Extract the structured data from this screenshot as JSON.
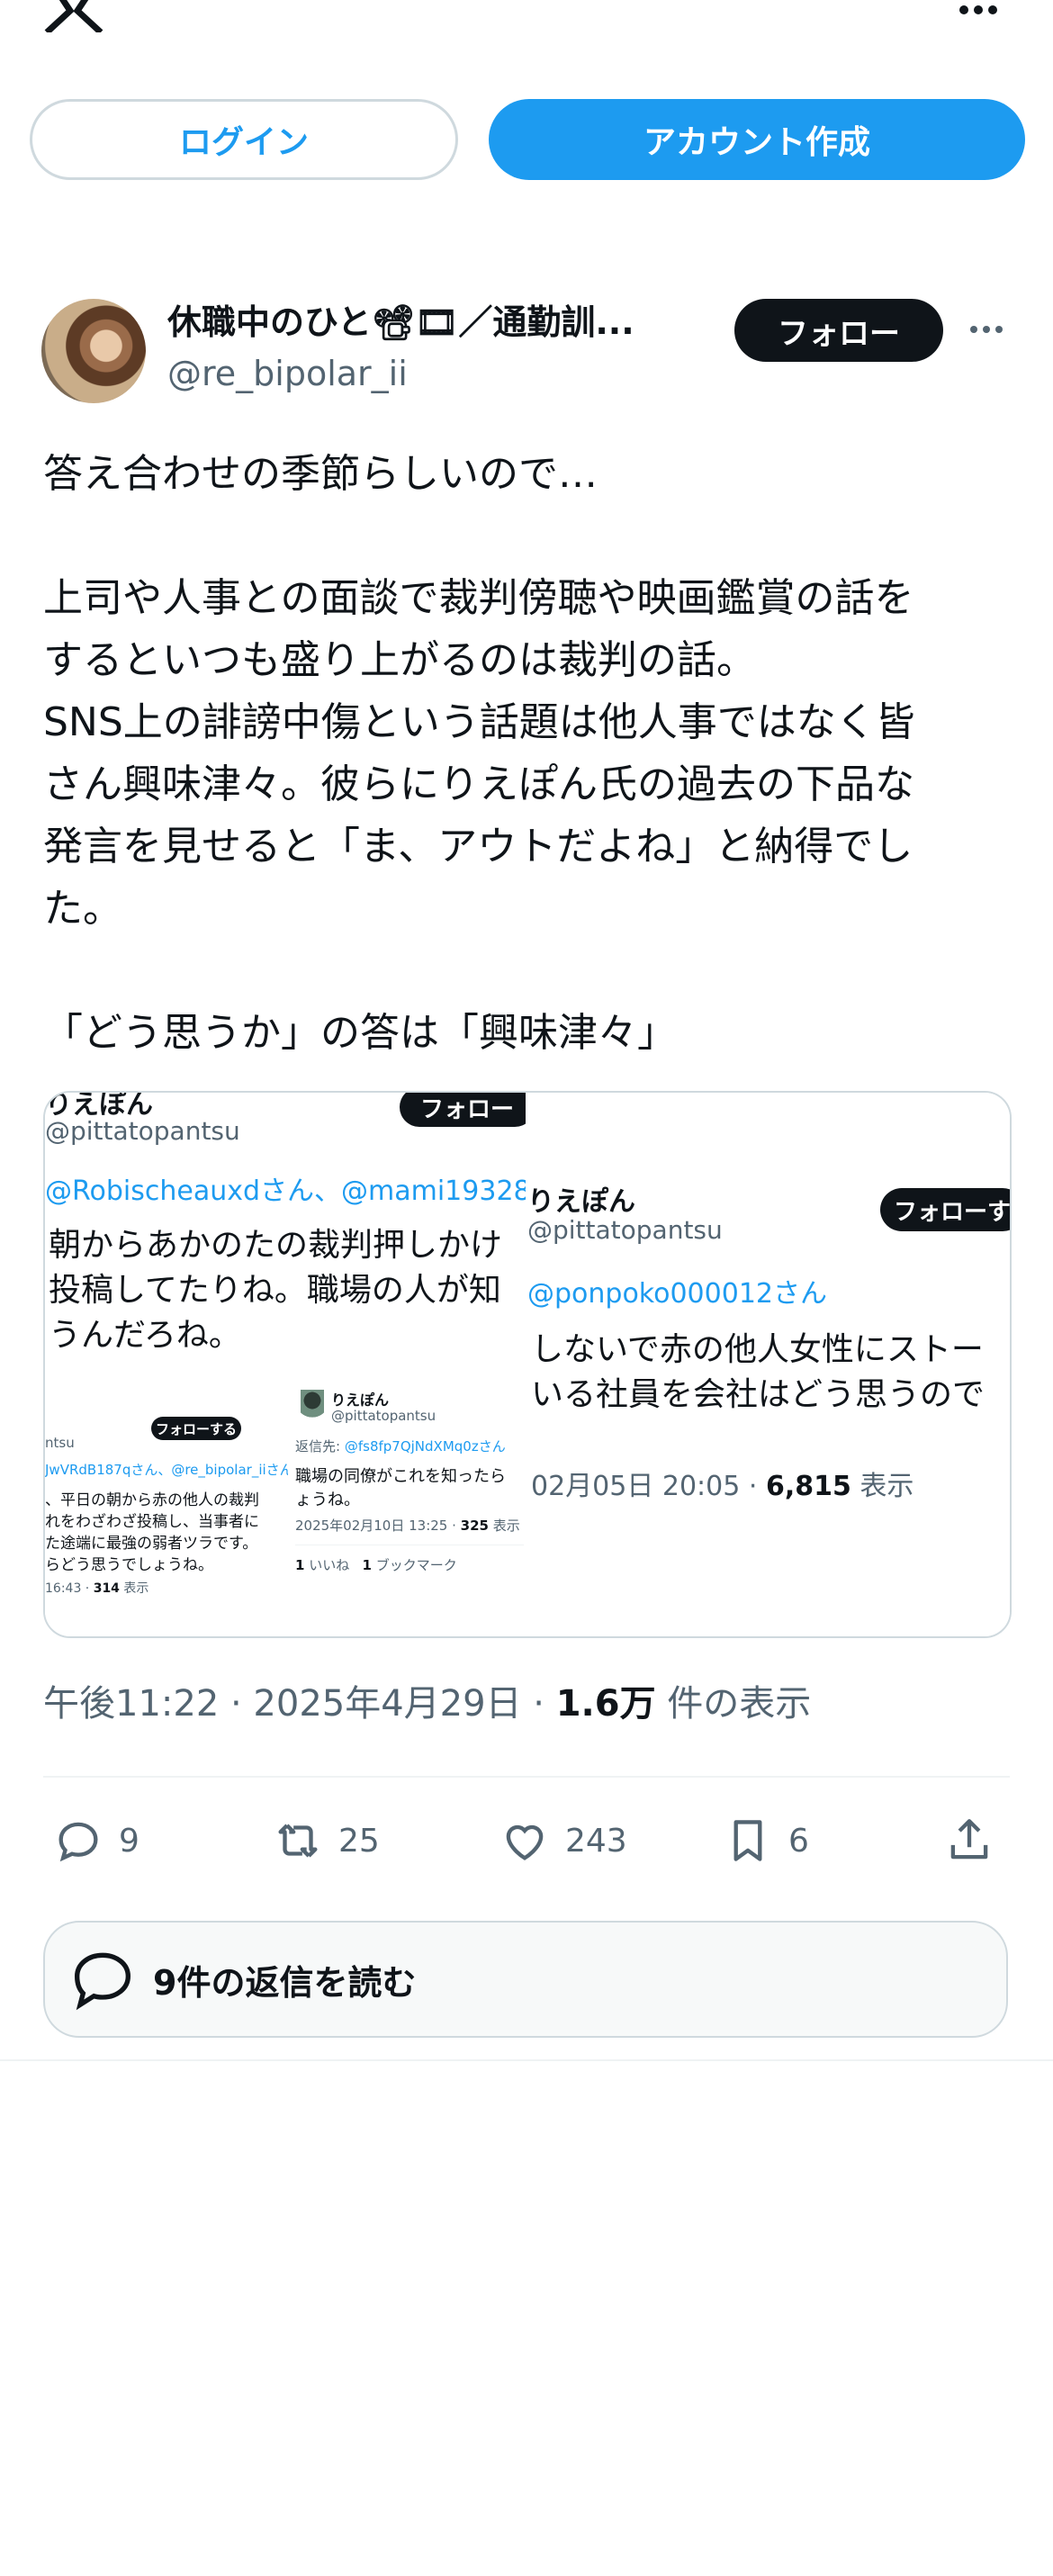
{
  "header": {
    "logo_icon": "x-logo-icon",
    "more_icon": "more-icon"
  },
  "auth": {
    "login_label": "ログイン",
    "signup_label": "アカウント作成"
  },
  "author": {
    "name": "休職中のひと📽🎞／通勤訓...",
    "handle": "@re_bipolar_ii",
    "follow_label": "フォロー"
  },
  "tweet": {
    "lines": [
      "答え合わせの季節らしいので…",
      "",
      "上司や人事との面談で裁判傍聴や映画鑑賞の話を",
      "するといつも盛り上がるのは裁判の話。",
      "SNS上の誹謗中傷という話題は他人事ではなく皆",
      "さん興味津々。彼らにりえぽん氏の過去の下品な",
      "発言を見せると「ま、アウトだよね」と納得でし",
      "た。",
      "",
      "「どう思うか」の答は「興味津々」"
    ]
  },
  "media": {
    "left": {
      "name": "りえぽん",
      "handle": "@pittatopantsu",
      "follow": "フォロー",
      "reply_to": "@Robischeauxdさん、@mami19328さ",
      "body1": "朝からあかのたの裁判押しかけ",
      "body2": "投稿してたりね。職場の人が知",
      "body3": "うんだろね。",
      "sub": {
        "follow": "フォローする",
        "handle": "ntsu",
        "reply": "JwVRdB187qさん、@re_bipolar_iiさん、",
        "line1": "、平日の朝から赤の他人の裁判",
        "line2": "れをわざわざ投稿し、当事者に",
        "line3": "た途端に最強の弱者ツラです。",
        "line4": "らどう思うでしょうね。",
        "stat_time": "16:43 ·",
        "stat_views": "314",
        "stat_label": "表示"
      },
      "sub2": {
        "name": "りえぽん",
        "handle": "@pittatopantsu",
        "reply_prefix": "返信先:",
        "reply_to": "@fs8fp7QjNdXMq0zさん",
        "line1": "職場の同僚がこれを知ったら",
        "line2": "ょうね。",
        "stat_time": "2025年02月10日 13:25 ·",
        "stat_views": "325",
        "stat_label": "表示",
        "likes_count": "1",
        "likes_label": "いいね",
        "bm_count": "1",
        "bm_label": "ブックマーク"
      }
    },
    "right": {
      "name": "りえぽん",
      "handle": "@pittatopantsu",
      "follow": "フォローす",
      "reply_to": "@ponpoko000012さん",
      "body1": "しないで赤の他人女性にストー",
      "body2": "いる社員を会社はどう思うので",
      "stat_time": "02月05日 20:05 ·",
      "stat_views": "6,815",
      "stat_label": "表示"
    }
  },
  "meta": {
    "time": "午後11:22 · 2025年4月29日 · ",
    "views": "1.6万",
    "views_label": " 件の表示"
  },
  "actions": {
    "replies": "9",
    "reposts": "25",
    "likes": "243",
    "bookmarks": "6"
  },
  "read_replies_label": "9件の返信を読む"
}
